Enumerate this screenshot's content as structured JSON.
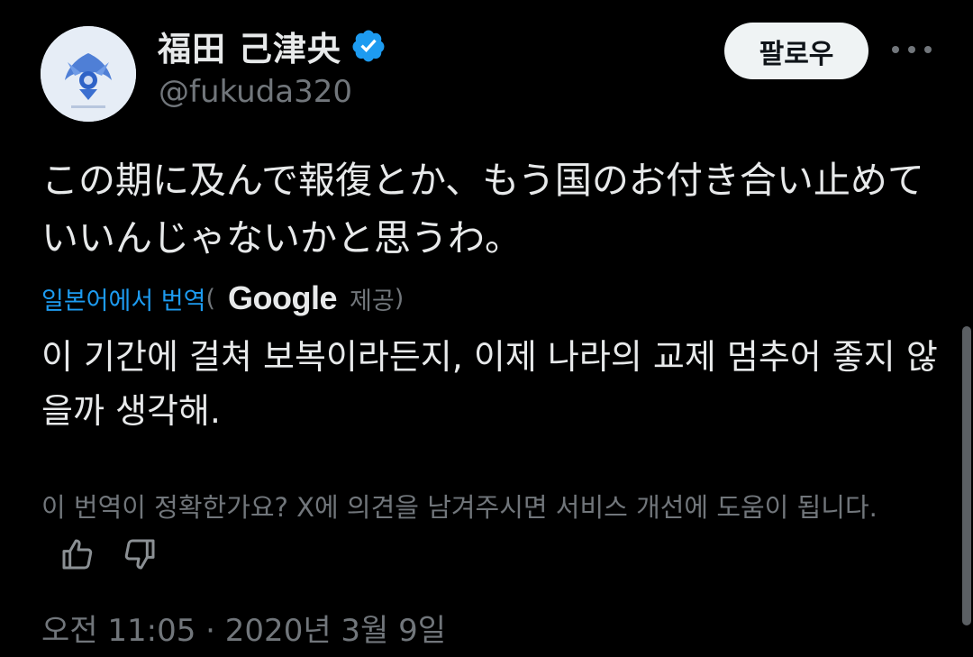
{
  "author": {
    "display_name": "福田 己津央",
    "handle": "@fukuda320",
    "verified": true,
    "avatar": "winged-emblem-avatar"
  },
  "header": {
    "follow_label": "팔로우",
    "more_icon": "more-horizontal-icon"
  },
  "tweet": {
    "text": "この期に及んで報復とか、もう国のお付き合い止めていいんじゃないかと思うわ。"
  },
  "translation": {
    "from_label": "일본어에서 번역",
    "paren_open": "(",
    "provider": "Google",
    "provided_by": "제공",
    "paren_close": ")",
    "text": "이 기간에 걸쳐 보복이라든지, 이제 나라의 교제 멈추어 좋지 않을까 생각해.",
    "feedback_prompt": "이 번역이 정확한가요? X에 의견을 남겨주시면 서비스 개선에 도움이 됩니다."
  },
  "timestamp": {
    "time": "오전 11:05",
    "separator": " · ",
    "date": "2020년 3월 9일"
  },
  "colors": {
    "background": "#000000",
    "text_primary": "#e7e9ea",
    "text_secondary": "#71767b",
    "link": "#1d9bf0",
    "verified": "#1d9bf0",
    "button_bg": "#eff3f4"
  }
}
